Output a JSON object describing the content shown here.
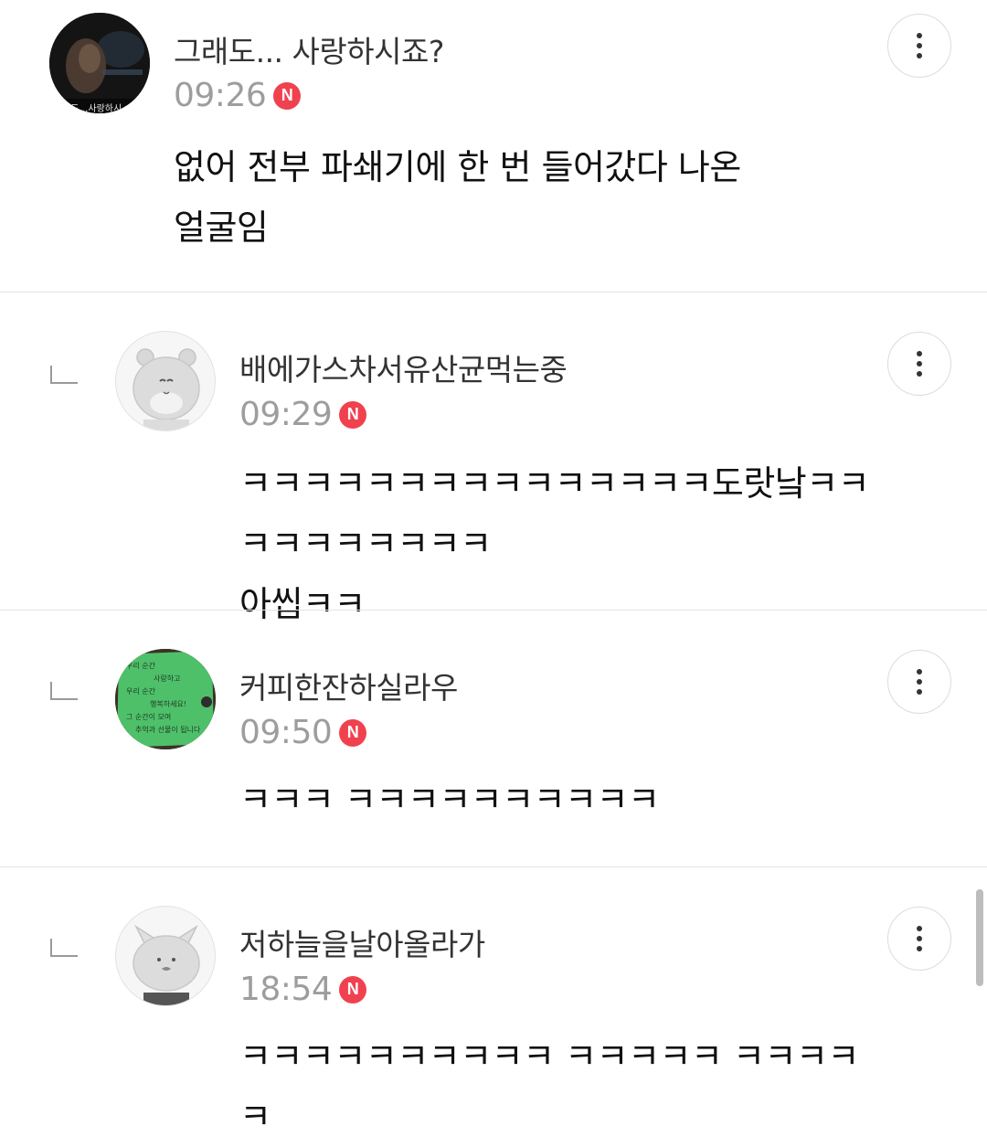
{
  "comments": [
    {
      "nickname": "그래도... 사랑하시죠?",
      "time": "09:26",
      "badge": "N",
      "text": "없어 전부 파쇄기에 한 번 들어갔다 나온\n얼굴임",
      "avatar_caption": "래도…사랑하시",
      "is_reply": false
    },
    {
      "nickname": "배에가스차서유산균먹는중",
      "time": "09:29",
      "badge": "N",
      "text": "ㅋㅋㅋㅋㅋㅋㅋㅋㅋㅋㅋㅋㅋㅋㅋ도랏낰ㅋㅋㅋㅋㅋㅋㅋㅋㅋㅋ\n아씹ㅋㅋ",
      "is_reply": true
    },
    {
      "nickname": "커피한잔하실라우",
      "time": "09:50",
      "badge": "N",
      "text": "ㅋㅋㅋ ㅋㅋㅋㅋㅋㅋㅋㅋㅋㅋ",
      "avatar_note": [
        "우리 순간",
        "사랑하고",
        "우리 순간",
        "행복하세요!",
        "그 순간이 모여",
        "추억과 선물이 됩니다"
      ],
      "is_reply": true
    },
    {
      "nickname": "저하늘을날아올라가",
      "time": "18:54",
      "badge": "N",
      "text": "ㅋㅋㅋㅋㅋㅋㅋㅋㅋㅋ ㅋㅋㅋㅋㅋ ㅋㅋㅋㅋㅋ",
      "is_reply": true
    }
  ],
  "icons": {
    "more": "more-vertical-icon",
    "reply": "reply-corner-icon",
    "new": "new-badge-icon"
  },
  "colors": {
    "badge": "#f0414f",
    "time": "#9d9d9d",
    "divider": "#e4e4e4"
  }
}
